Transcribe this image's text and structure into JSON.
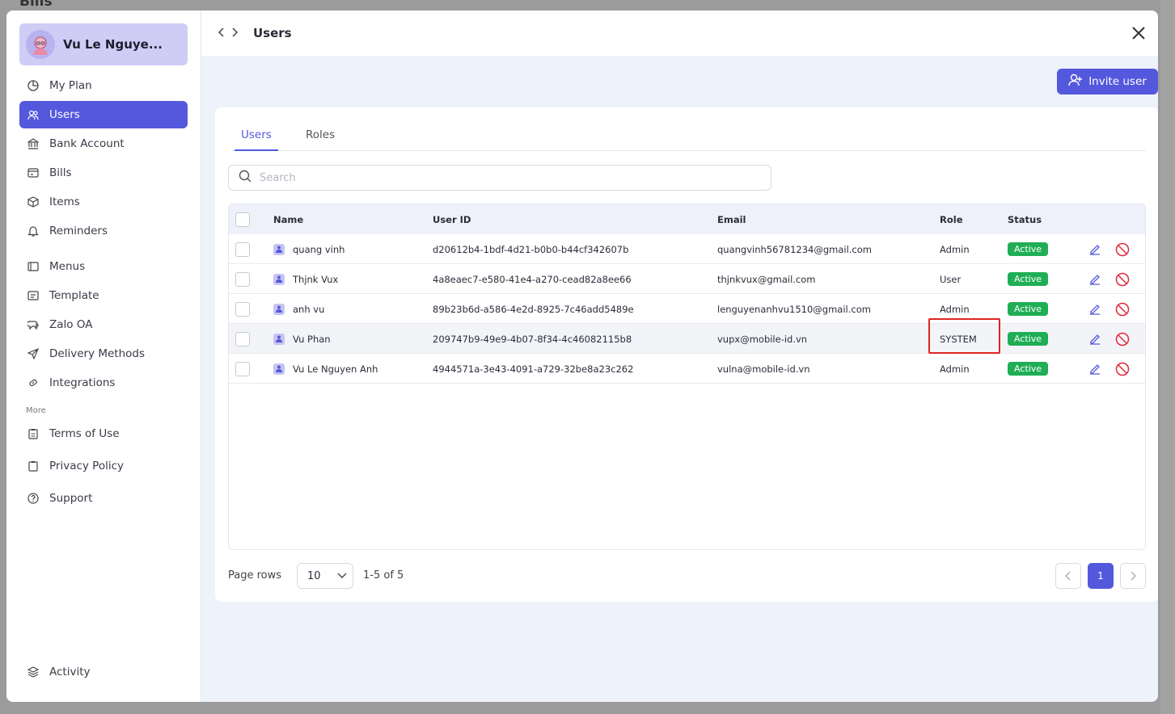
{
  "background": {
    "title": "Bills"
  },
  "profile": {
    "name": "Vu Le Nguye..."
  },
  "sidebar": {
    "items": [
      {
        "label": "My Plan",
        "icon": "pie-chart-icon"
      },
      {
        "label": "Users",
        "icon": "users-icon"
      },
      {
        "label": "Bank Account",
        "icon": "bank-icon"
      },
      {
        "label": "Bills",
        "icon": "bill-icon"
      },
      {
        "label": "Items",
        "icon": "box-icon"
      },
      {
        "label": "Reminders",
        "icon": "bell-icon"
      },
      {
        "label": "Menus",
        "icon": "menu-icon"
      },
      {
        "label": "Template",
        "icon": "template-icon"
      },
      {
        "label": "Zalo OA",
        "icon": "chat-icon"
      },
      {
        "label": "Delivery Methods",
        "icon": "send-icon"
      },
      {
        "label": "Integrations",
        "icon": "link-icon"
      }
    ],
    "more_label": "More",
    "more_items": [
      {
        "label": "Terms of Use",
        "icon": "clipboard-icon"
      },
      {
        "label": "Privacy Policy",
        "icon": "clipboard-icon"
      },
      {
        "label": "Support",
        "icon": "help-icon"
      }
    ],
    "bottom_item": {
      "label": "Activity",
      "icon": "layers-icon"
    }
  },
  "header": {
    "title": "Users"
  },
  "actions": {
    "invite_label": "Invite user"
  },
  "tabs": [
    {
      "label": "Users"
    },
    {
      "label": "Roles"
    }
  ],
  "search": {
    "placeholder": "Search"
  },
  "table": {
    "columns": [
      "Name",
      "User ID",
      "Email",
      "Role",
      "Status"
    ],
    "rows": [
      {
        "name": "quang vinh",
        "user_id": "d20612b4-1bdf-4d21-b0b0-b44cf342607b",
        "email": "quangvinh56781234@gmail.com",
        "role": "Admin",
        "status": "Active"
      },
      {
        "name": "Thjnk Vux",
        "user_id": "4a8eaec7-e580-41e4-a270-cead82a8ee66",
        "email": "thjnkvux@gmail.com",
        "role": "User",
        "status": "Active"
      },
      {
        "name": "anh vu",
        "user_id": "89b23b6d-a586-4e2d-8925-7c46add5489e",
        "email": "lenguyenanhvu1510@gmail.com",
        "role": "Admin",
        "status": "Active"
      },
      {
        "name": "Vu Phan",
        "user_id": "209747b9-49e9-4b07-8f34-4c46082115b8",
        "email": "vupx@mobile-id.vn",
        "role": "SYSTEM",
        "status": "Active"
      },
      {
        "name": "Vu Le Nguyen Anh",
        "user_id": "4944571a-3e43-4091-a729-32be8a23c262",
        "email": "vulna@mobile-id.vn",
        "role": "Admin",
        "status": "Active"
      }
    ]
  },
  "pagination": {
    "rows_label": "Page rows",
    "rows_value": "10",
    "range": "1-5 of 5",
    "current_page": "1"
  },
  "colors": {
    "accent": "#5458dd",
    "active_badge": "#1fae55",
    "highlight": "#e02424",
    "danger": "#e0283c"
  }
}
